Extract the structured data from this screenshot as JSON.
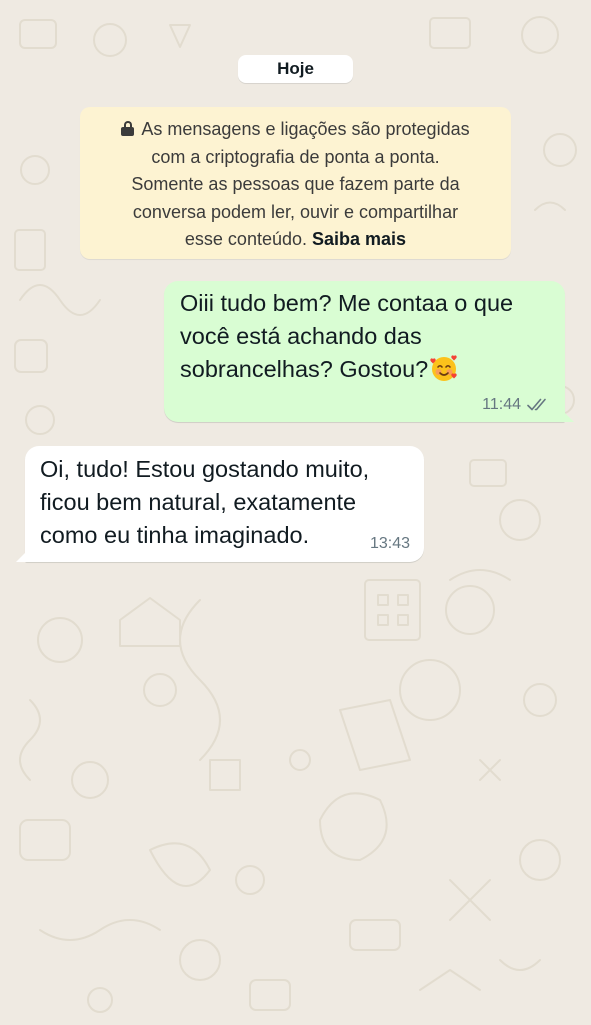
{
  "chat": {
    "date_divider": "Hoje",
    "encryption_notice": {
      "lines": [
        "As mensagens e ligações são protegidas",
        "com a criptografia de ponta a ponta.",
        "Somente as pessoas que fazem parte da",
        "conversa podem ler, ouvir e compartilhar",
        "esse conteúdo."
      ],
      "link_text": "Saiba mais",
      "icon": "lock-icon"
    },
    "messages": [
      {
        "direction": "outgoing",
        "text_lines": [
          "Oiii tudo bem? Me contaa o que",
          "você está achando das",
          "sobrancelhas? Gostou?"
        ],
        "emoji": "smiling-face-with-hearts",
        "time": "11:44",
        "status": "read"
      },
      {
        "direction": "incoming",
        "text_lines": [
          "Oi, tudo! Estou gostando muito,",
          "ficou bem natural, exatamente",
          "como eu tinha imaginado."
        ],
        "time": "13:43"
      }
    ]
  },
  "colors": {
    "wallpaper": "#efeae2",
    "outgoing_bubble": "#d9fdd3",
    "incoming_bubble": "#ffffff",
    "notice_bubble": "#fdf3d2",
    "meta_text": "#667781",
    "read_check": "#667781"
  }
}
